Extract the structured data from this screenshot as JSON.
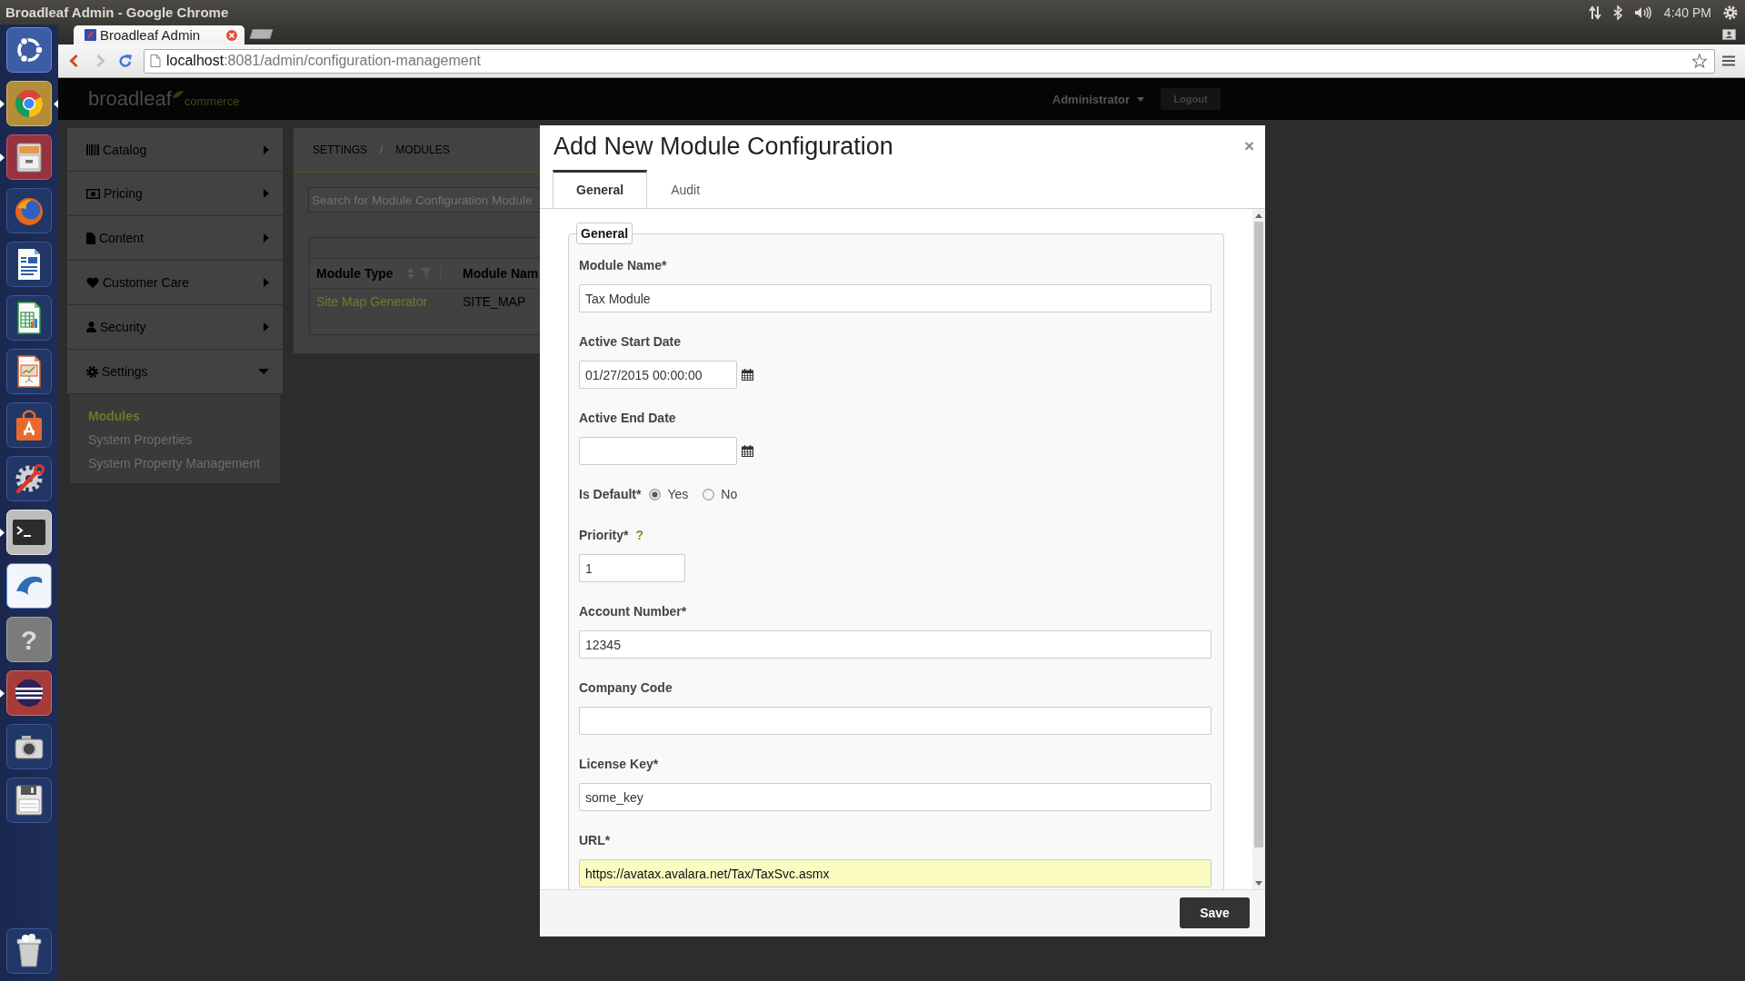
{
  "top_panel": {
    "title": "Broadleaf Admin - Google Chrome",
    "clock": "4:40 PM"
  },
  "launcher": {
    "items": [
      {
        "kind": "dash",
        "running": false,
        "focused": false
      },
      {
        "kind": "browser",
        "running": true,
        "focused": true
      },
      {
        "kind": "files",
        "running": true,
        "focused": false
      },
      {
        "kind": "web",
        "running": false,
        "focused": false
      },
      {
        "kind": "writer",
        "running": false,
        "focused": false
      },
      {
        "kind": "calc",
        "running": false,
        "focused": false
      },
      {
        "kind": "impress",
        "running": false,
        "focused": false
      },
      {
        "kind": "store",
        "running": false,
        "focused": false
      },
      {
        "kind": "settings",
        "running": false,
        "focused": false
      },
      {
        "kind": "terminal",
        "running": true,
        "focused": false
      },
      {
        "kind": "database",
        "running": false,
        "focused": false
      },
      {
        "kind": "help",
        "glyph": "?",
        "running": false,
        "focused": false
      },
      {
        "kind": "ide",
        "running": true,
        "focused": false
      },
      {
        "kind": "camera",
        "running": false,
        "focused": false
      },
      {
        "kind": "disk",
        "running": false,
        "focused": false
      },
      {
        "kind": "trash",
        "running": false,
        "focused": false
      }
    ]
  },
  "browser": {
    "tabs": [
      {
        "title": "Broadleaf Admin",
        "selected": true
      }
    ],
    "nav": [
      {
        "kind": "back",
        "disabled": false
      },
      {
        "kind": "forward",
        "disabled": true
      },
      {
        "kind": "reload",
        "disabled": false
      }
    ],
    "address": {
      "host": "localhost",
      "path": ":8081/admin/configuration-management"
    }
  },
  "header": {
    "logo": {
      "name": "broadleaf",
      "tagline": "commerce"
    },
    "user": "Administrator",
    "logout": "Logout"
  },
  "sidebar": {
    "items": [
      {
        "kind": "catalog",
        "label": "Catalog",
        "expanded": false
      },
      {
        "kind": "pricing",
        "label": "Pricing",
        "expanded": false
      },
      {
        "kind": "content",
        "label": "Content",
        "expanded": false
      },
      {
        "kind": "customer_care",
        "label": "Customer Care",
        "expanded": false
      },
      {
        "kind": "security",
        "label": "Security",
        "expanded": false
      },
      {
        "kind": "settings",
        "label": "Settings",
        "expanded": true,
        "children": [
          {
            "label": "Modules",
            "selected": true
          },
          {
            "label": "System Properties",
            "selected": false
          },
          {
            "label": "System Property Management",
            "selected": false
          }
        ]
      }
    ]
  },
  "content": {
    "breadcrumb": {
      "items": [
        "SETTINGS",
        "MODULES"
      ],
      "separator": "/"
    },
    "search": {
      "placeholder": "Search for Module Configuration Module"
    },
    "table": {
      "columns": [
        {
          "label": "Module Type",
          "sort_filter": true
        },
        {
          "label": "Module Nam"
        }
      ],
      "rows": [
        [
          {
            "kind": "link",
            "text": "Site Map Generator"
          },
          {
            "kind": "text",
            "text": "SITE_MAP"
          }
        ]
      ]
    }
  },
  "modal": {
    "title": "Add New Module Configuration",
    "close": "×",
    "tabs": [
      {
        "label": "General",
        "selected": true
      },
      {
        "label": "Audit",
        "selected": false
      }
    ],
    "legend": "General",
    "fields": [
      {
        "kind": "text",
        "label": "Module Name*",
        "value": "Tax Module",
        "autofilled": false
      },
      {
        "kind": "date",
        "label": "Active Start Date",
        "value": "01/27/2015 00:00:00",
        "autofilled": false
      },
      {
        "kind": "date",
        "label": "Active End Date",
        "autofilled": false
      },
      {
        "kind": "radio",
        "label": "Is Default*",
        "options": [
          {
            "label": "Yes",
            "selected": true
          },
          {
            "label": "No",
            "selected": false
          }
        ]
      },
      {
        "kind": "number",
        "label": "Priority*",
        "help": "?",
        "value": "1",
        "autofilled": false
      },
      {
        "kind": "text",
        "label": "Account Number*",
        "value": "12345",
        "autofilled": false
      },
      {
        "kind": "text",
        "label": "Company Code",
        "autofilled": false
      },
      {
        "kind": "text",
        "label": "License Key*",
        "value": "some_key",
        "autofilled": false
      },
      {
        "kind": "text",
        "label": "URL*",
        "value": "https://avatax.avalara.net/Tax/TaxSvc.asmx",
        "autofilled": true
      }
    ],
    "save": "Save"
  }
}
